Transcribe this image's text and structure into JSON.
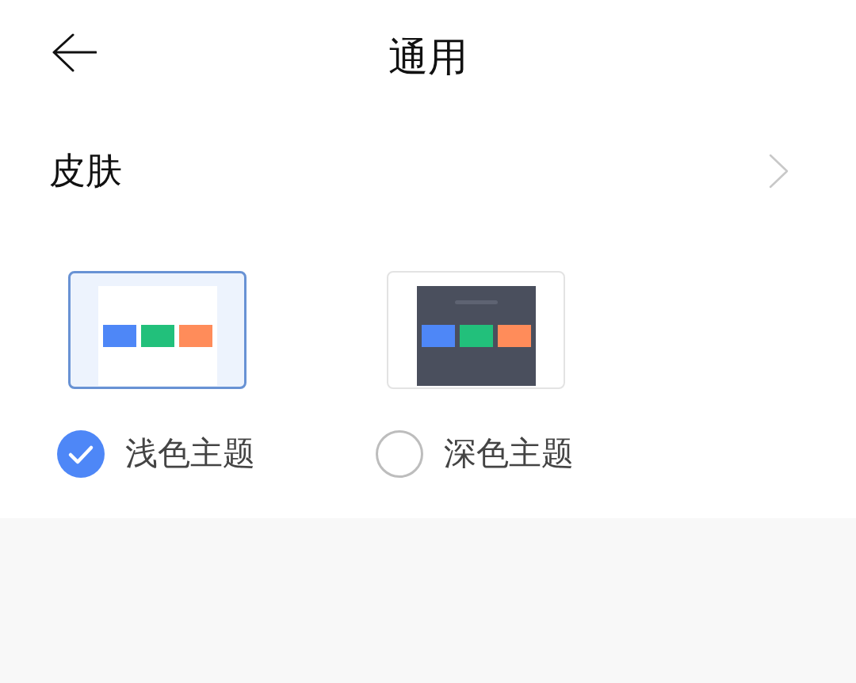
{
  "header": {
    "title": "通用"
  },
  "skin_row": {
    "label": "皮肤"
  },
  "themes": [
    {
      "kind": "light",
      "label": "浅色主题",
      "selected": true
    },
    {
      "kind": "dark",
      "label": "深色主题",
      "selected": false
    }
  ]
}
